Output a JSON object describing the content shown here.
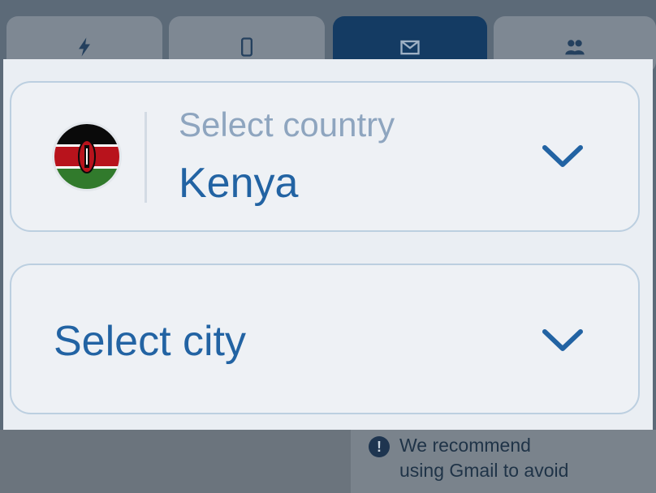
{
  "background": {
    "tabs": [
      {
        "icon": "lightning-icon",
        "active": false
      },
      {
        "icon": "phone-icon",
        "active": false
      },
      {
        "icon": "envelope-icon",
        "active": true
      },
      {
        "icon": "users-icon",
        "active": false
      }
    ],
    "notice_lines": [
      "We recommend",
      "using Gmail to avoid"
    ]
  },
  "country_select": {
    "label": "Select country",
    "value": "Kenya",
    "flag_icon": "kenya-flag-icon"
  },
  "city_select": {
    "label": "Select city"
  },
  "colors": {
    "accent": "#2263a3",
    "label_muted": "#8ea5bf",
    "border": "#bccfe0",
    "active_tab": "#143b63"
  }
}
